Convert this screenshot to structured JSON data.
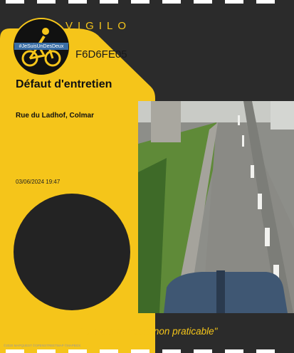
{
  "header": {
    "brand": "VIGILO",
    "reference": "F6D6FE05"
  },
  "logo": {
    "hashtag": "#JeSuisUnDesDeux"
  },
  "report": {
    "type": "Défaut d'entretien",
    "address": "Rue du Ladhof,  Colmar",
    "datetime": "03/06/2024 19:47",
    "comment": "\"La piste cyclable non praticable\""
  },
  "map": {
    "credit": "©2020 MAPQUEST ©OPENSTREETMAP ©MAPBOX"
  },
  "colors": {
    "accent": "#f5c51a",
    "background": "#2b2b2b"
  }
}
